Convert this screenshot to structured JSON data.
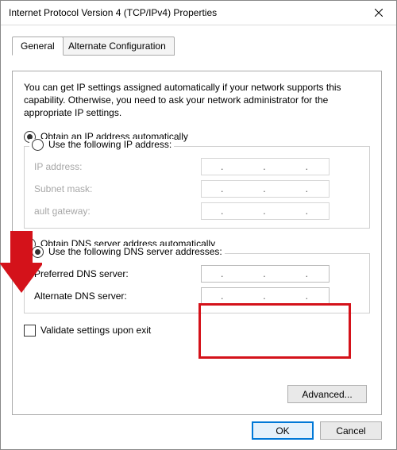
{
  "window": {
    "title": "Internet Protocol Version 4 (TCP/IPv4) Properties"
  },
  "tabs": {
    "general": "General",
    "alt": "Alternate Configuration"
  },
  "intro": "You can get IP settings assigned automatically if your network supports this capability. Otherwise, you need to ask your network administrator for the appropriate IP settings.",
  "ip": {
    "auto": "Obtain an IP address automatically",
    "manual": "Use the following IP address:",
    "addr": "IP address:",
    "mask": "Subnet mask:",
    "gw": "ault gateway:"
  },
  "dns": {
    "auto": "Obtain DNS server address automatically",
    "manual": "Use the following DNS server addresses:",
    "pref": "Preferred DNS server:",
    "alt": "Alternate DNS server:"
  },
  "validate": "Validate settings upon exit",
  "buttons": {
    "advanced": "Advanced...",
    "ok": "OK",
    "cancel": "Cancel"
  },
  "dot": "."
}
